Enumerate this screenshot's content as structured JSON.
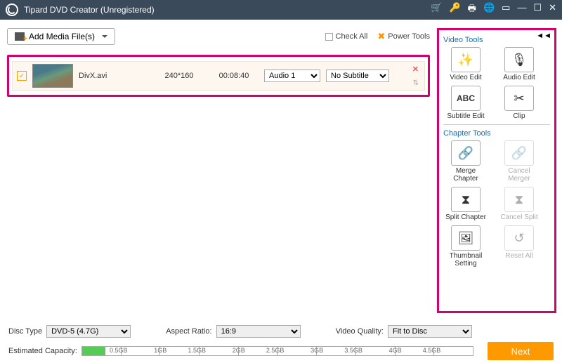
{
  "titlebar": {
    "title": "Tipard DVD Creator (Unregistered)"
  },
  "toolbar": {
    "add_media": "Add Media File(s)",
    "check_all": "Check All",
    "power_tools": "Power Tools"
  },
  "file": {
    "name": "DivX.avi",
    "dimensions": "240*160",
    "duration": "00:08:40",
    "audio_selected": "Audio 1",
    "subtitle_selected": "No Subtitle"
  },
  "sidebar": {
    "video_tools_title": "Video Tools",
    "chapter_tools_title": "Chapter Tools",
    "video_edit": "Video Edit",
    "audio_edit": "Audio Edit",
    "subtitle_edit": "Subtitle Edit",
    "clip": "Clip",
    "merge_chapter": "Merge Chapter",
    "cancel_merger": "Cancel Merger",
    "split_chapter": "Split Chapter",
    "cancel_split": "Cancel Split",
    "thumbnail_setting": "Thumbnail Setting",
    "reset_all": "Reset All"
  },
  "bottom": {
    "disc_type_label": "Disc Type",
    "disc_type_value": "DVD-5 (4.7G)",
    "aspect_label": "Aspect Ratio:",
    "aspect_value": "16:9",
    "quality_label": "Video Quality:",
    "quality_value": "Fit to Disc",
    "capacity_label": "Estimated Capacity:",
    "ticks": [
      "0.5GB",
      "1GB",
      "1.5GB",
      "2GB",
      "2.5GB",
      "3GB",
      "3.5GB",
      "4GB",
      "4.5GB"
    ],
    "next": "Next"
  }
}
